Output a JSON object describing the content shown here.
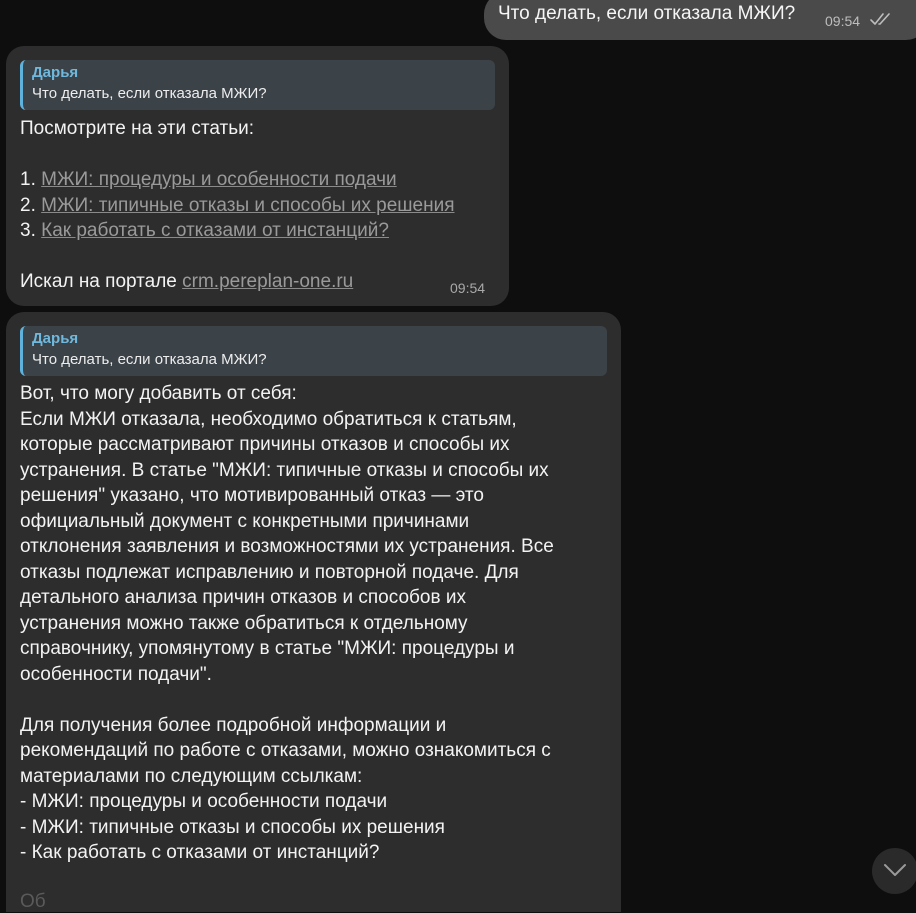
{
  "outgoing": {
    "text": "Что делать, если отказала МЖИ?",
    "time": "09:54",
    "status_icon": "double-check-icon"
  },
  "reply1": {
    "quote": {
      "author": "Дарья",
      "text": "Что делать, если отказала МЖИ?"
    },
    "intro": "Посмотрите на эти статьи:",
    "articles": [
      {
        "num": "1.",
        "title": "МЖИ: процедуры и особенности подачи"
      },
      {
        "num": "2.",
        "title": "МЖИ: типичные отказы и способы их решения"
      },
      {
        "num": "3.",
        "title": "Как работать с отказами от инстанций?"
      }
    ],
    "source_prefix": "Искал на портале",
    "source_link": "crm.pereplan-one.ru",
    "time": "09:54"
  },
  "reply2": {
    "quote": {
      "author": "Дарья",
      "text": "Что делать, если отказала МЖИ?"
    },
    "paragraph1": [
      "Вот, что могу добавить от себя:",
      "Если МЖИ отказала, необходимо обратиться к статьям,",
      "которые рассматривают причины отказов и способы их",
      "устранения. В статье \"МЖИ: типичные отказы и способы их",
      "решения\" указано, что мотивированный отказ — это",
      "официальный документ с конкретными причинами",
      "отклонения заявления и возможностями их устранения. Все",
      "отказы подлежат исправлению и повторной подаче. Для",
      "детального анализа причин отказов и способов их",
      "устранения можно также обратиться к отдельному",
      "справочнику, упомянутому в статье \"МЖИ: процедуры и",
      "особенности подачи\"."
    ],
    "paragraph2": [
      "Для получения более подробной информации и",
      "рекомендаций по работе с отказами, можно ознакомиться с",
      "материалами по следующим ссылкам:",
      "- МЖИ: процедуры и особенности подачи",
      "- МЖИ: типичные отказы и способы их решения",
      "- Как работать с отказами от инстанций?"
    ],
    "cut_off_line": "Об"
  },
  "scroll_button": {
    "icon": "chevron-down-icon"
  }
}
